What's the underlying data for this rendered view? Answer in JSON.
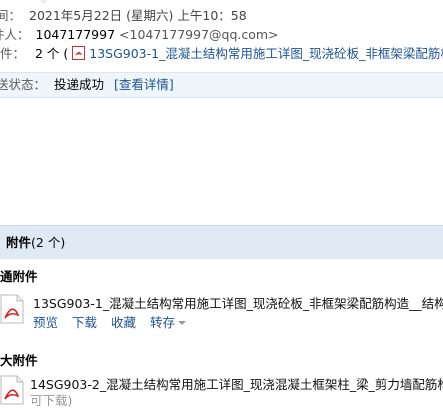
{
  "header": {
    "time_label": "间：",
    "time_value": "2021年5月22日 (星期六) 上午10：58",
    "recipient_label": "件人：",
    "recipient_qq": "1047177997",
    "recipient_email": "<1047177997@qq.com>",
    "attach_label": "件：",
    "attach_count": "2 个 (",
    "attach_first_name": "13SG903-1_混凝土结构常用施工详图_现浇砼板_非框架梁配筋构"
  },
  "status": {
    "label": "送状态：",
    "value": "投递成功",
    "details_link": "[查看详情]"
  },
  "attachments": {
    "title": "附件",
    "count": "(2 个)",
    "normal_section_title": "通附件",
    "normal_file_name": "13SG903-1_混凝土结构常用施工详图_现浇砼板_非框架梁配筋构造__结构",
    "actions": [
      "预览",
      "下载",
      "收藏",
      "转存"
    ],
    "large_section_title": "大附件",
    "large_file_name": "14SG903-2_混凝土结构常用施工详图_现浇混凝土框架柱_梁_剪力墙配筋构",
    "large_file_action": "可下载)"
  }
}
